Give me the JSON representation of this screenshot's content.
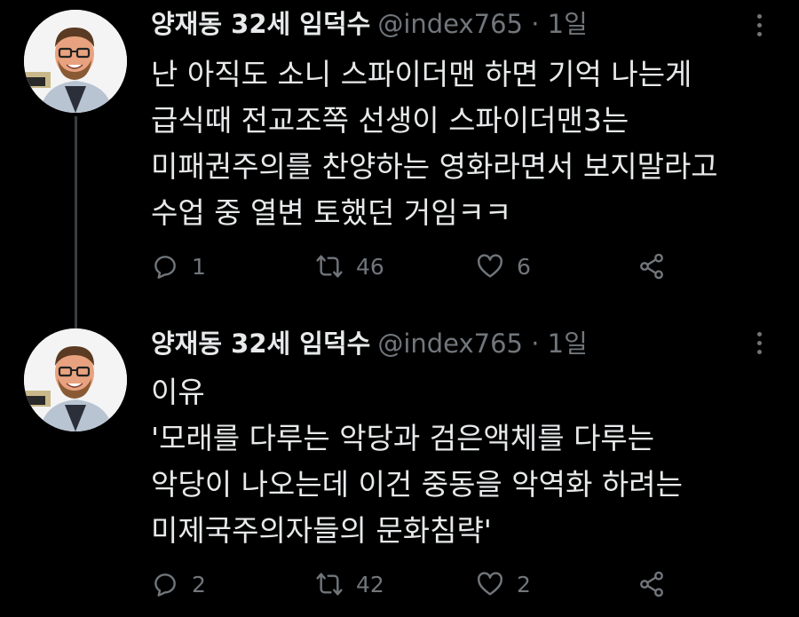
{
  "tweets": [
    {
      "author_name": "양재동 32세 임덕수",
      "handle": "@index765",
      "separator": "·",
      "time": "1일",
      "body_lines": [
        "난 아직도 소니 스파이더맨 하면 기억 나는게",
        "급식때 전교조쪽 선생이 스파이더맨3는",
        "미패권주의를 찬양하는 영화라면서 보지말라고",
        "수업 중 열변 토했던 거임ㅋㅋ"
      ],
      "replies": "1",
      "retweets": "46",
      "likes": "6"
    },
    {
      "author_name": "양재동 32세 임덕수",
      "handle": "@index765",
      "separator": "·",
      "time": "1일",
      "body_lines": [
        "이유",
        "'모래를 다루는 악당과 검은액체를 다루는",
        "악당이 나오는데 이건 중동을 악역화 하려는",
        "미제국주의자들의 문화침략'"
      ],
      "replies": "2",
      "retweets": "42",
      "likes": "2"
    }
  ],
  "icons": {
    "reply": "reply-icon",
    "retweet": "retweet-icon",
    "like": "heart-icon",
    "share": "share-icon",
    "more": "more-icon"
  },
  "colors": {
    "background": "#000000",
    "text": "#e7e9ea",
    "muted": "#71767b",
    "thread_line": "#3a3d40"
  }
}
